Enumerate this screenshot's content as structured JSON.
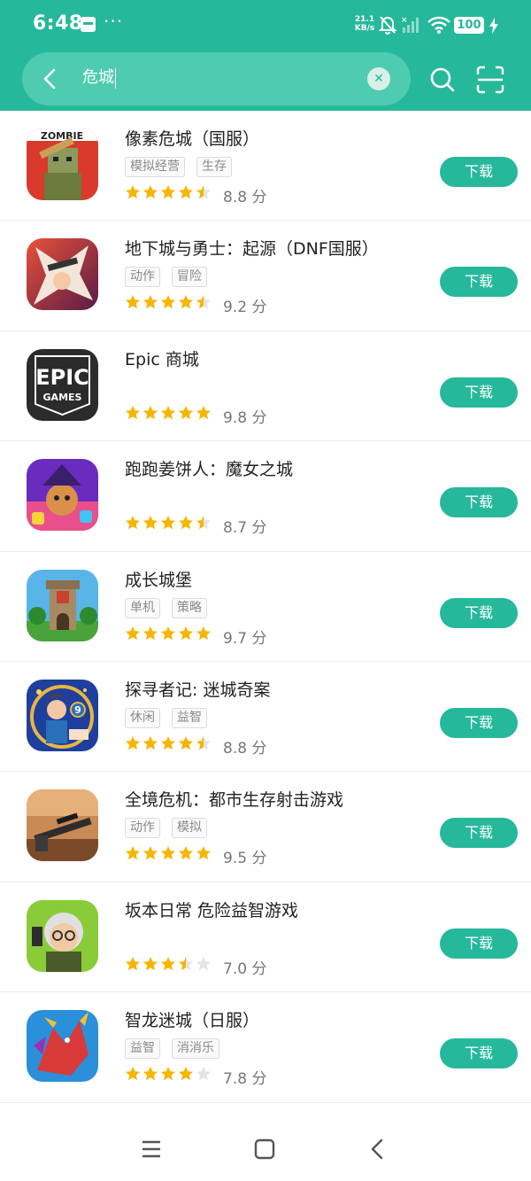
{
  "status": {
    "time": "6:48",
    "dots": "···",
    "speed_value": "21.1",
    "speed_unit": "KB/s",
    "battery": "100"
  },
  "search": {
    "query": "危城"
  },
  "colors": {
    "accent": "#26b89a",
    "star": "#f7b500",
    "star_empty": "#e4e4e4"
  },
  "results": [
    {
      "title": "像素危城（国服）",
      "tags": [
        "模拟经营",
        "生存"
      ],
      "rating": 4.5,
      "score": "8.8 分",
      "button": "下载",
      "icon": "zombie-pixel-icon"
    },
    {
      "title": "地下城与勇士：起源（DNF国服）",
      "tags": [
        "动作",
        "冒险"
      ],
      "rating": 4.5,
      "score": "9.2 分",
      "button": "下载",
      "icon": "dnf-hero-icon"
    },
    {
      "title": "Epic 商城",
      "tags": [],
      "rating": 5,
      "score": "9.8 分",
      "button": "下载",
      "icon": "epic-games-icon",
      "icon_text_1": "EPIC",
      "icon_text_2": "GAMES"
    },
    {
      "title": "跑跑姜饼人：魔女之城",
      "tags": [],
      "rating": 4.5,
      "score": "8.7 分",
      "button": "下载",
      "icon": "cookie-witch-icon"
    },
    {
      "title": "成长城堡",
      "tags": [
        "单机",
        "策略"
      ],
      "rating": 5,
      "score": "9.7 分",
      "button": "下载",
      "icon": "castle-tower-icon"
    },
    {
      "title": "探寻者记: 迷城奇案",
      "tags": [
        "休闲",
        "益智"
      ],
      "rating": 4.5,
      "score": "8.8 分",
      "button": "下载",
      "icon": "seeker-woman-icon"
    },
    {
      "title": "全境危机：都市生存射击游戏",
      "tags": [
        "动作",
        "模拟"
      ],
      "rating": 5,
      "score": "9.5 分",
      "button": "下载",
      "icon": "sniper-rifle-icon"
    },
    {
      "title": "坂本日常 危险益智游戏",
      "tags": [],
      "rating": 3.5,
      "score": "7.0 分",
      "button": "下载",
      "icon": "sakamoto-granny-icon"
    },
    {
      "title": "智龙迷城（日服）",
      "tags": [
        "益智",
        "消消乐"
      ],
      "rating": 4,
      "score": "7.8 分",
      "button": "下载",
      "icon": "puzzle-dragon-icon"
    }
  ]
}
